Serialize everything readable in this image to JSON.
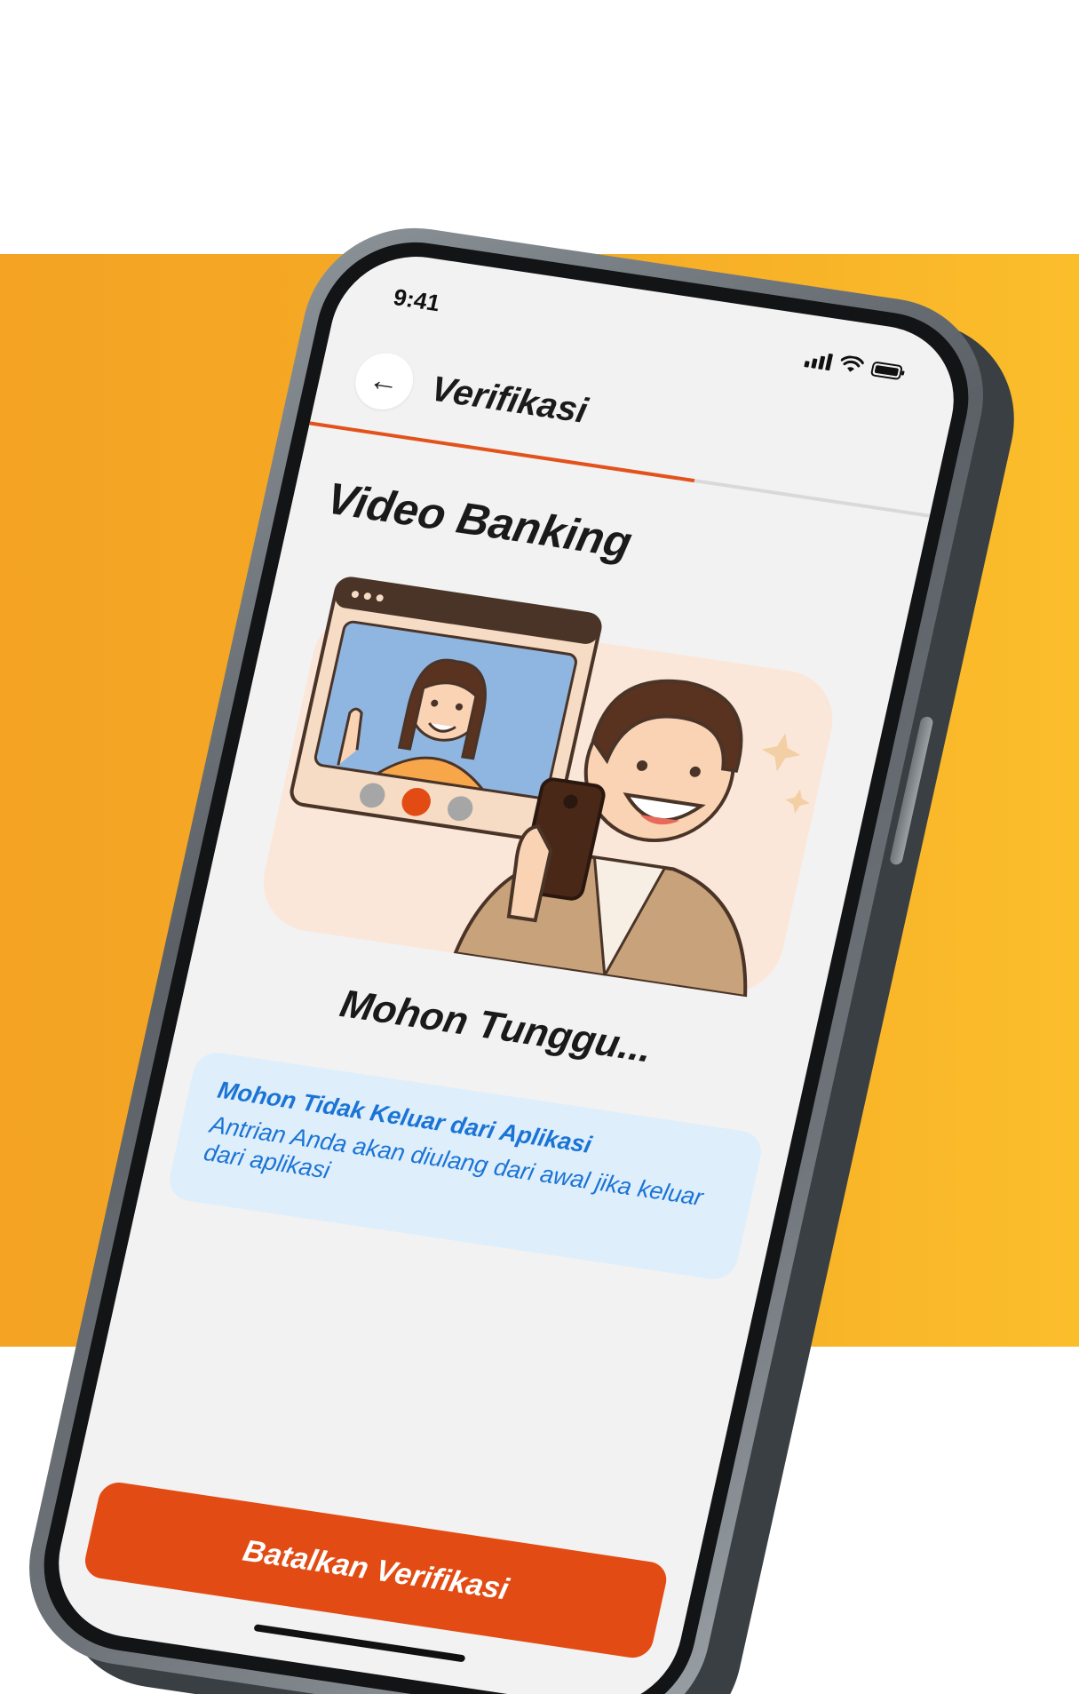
{
  "status_bar": {
    "time": "9:41",
    "icons": [
      "cellular-signal-icon",
      "wifi-icon",
      "battery-icon"
    ]
  },
  "header": {
    "back_icon": "arrow-left-icon",
    "back_glyph": "←",
    "title": "Verifikasi"
  },
  "progress": {
    "fraction": 0.62
  },
  "page": {
    "heading": "Video Banking",
    "illustration": "video-call-illustration"
  },
  "waiting_text": "Mohon Tunggu...",
  "info": {
    "title": "Mohon Tidak Keluar dari Aplikasi",
    "description": "Antrian Anda akan diulang dari awal jika keluar dari aplikasi"
  },
  "actions": {
    "cancel_label": "Batalkan Verifikasi"
  },
  "colors": {
    "accent": "#e24c14",
    "background_band": "#f6ac26",
    "info_text": "#1a74d6",
    "info_background": "#dfeefb"
  }
}
